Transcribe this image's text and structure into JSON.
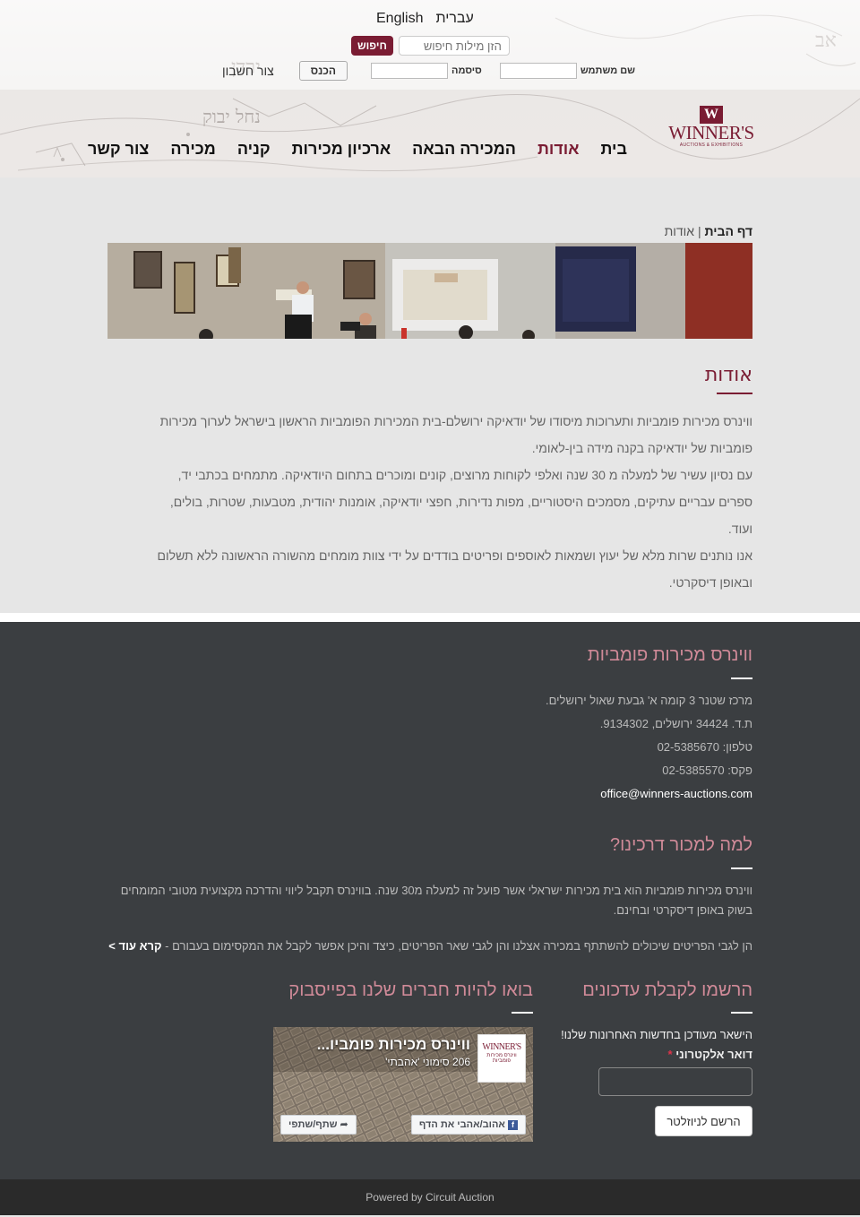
{
  "header": {
    "languages": [
      "English",
      "עברית"
    ],
    "search": {
      "placeholder": "הזן מילות חיפוש",
      "button": "חיפוש"
    },
    "login": {
      "username_label": "שם משתמש",
      "password_label": "סיסמה",
      "login_button": "הכנס",
      "create_account": "צור חשבון"
    },
    "logo": {
      "mark": "W",
      "name": "WINNER'S",
      "tagline": "AUCTIONS & EXHIBITIONS"
    },
    "nav": [
      "בית",
      "אודות",
      "המכירה הבאה",
      "ארכיון מכירות",
      "קניה",
      "מכירה",
      "צור קשר"
    ],
    "nav_active": "אודות"
  },
  "breadcrumb": {
    "home": "דף הבית",
    "separator": "|",
    "current": "אודות"
  },
  "about": {
    "title": "אודות",
    "paragraphs": [
      "ווינרס מכירות פומביות ותערוכות מיסודו של יודאיקה ירושלם-בית המכירות הפומביות הראשון בישראל לערוך מכירות",
      "פומביות של יודאיקה בקנה מידה בין-לאומי.",
      "עם נסיון עשיר של למעלה מ 30 שנה ואלפי לקוחות מרוצים, קונים ומוכרים בתחום היודאיקה. מתמחים בכתבי יד,",
      "ספרים עבריים עתיקים, מסמכים היסטוריים, מפות נדירות, חפצי יודאיקה, אומנות יהודית, מטבעות, שטרות, בולים,",
      "ועוד.",
      "אנו נותנים שרות מלא של יעוץ ושמאות לאוספים ופריטים בודדים על ידי צוות מומחים מהשורה הראשונה ללא תשלום",
      "ובאופן דיסקרטי."
    ]
  },
  "footer": {
    "contact": {
      "title": "ווינרס מכירות פומביות",
      "address": "מרכז שטנר 3 קומה א' גבעת שאול ירושלים.",
      "po_box": "ת.ד. 34424 ירושלים, 9134302.",
      "phone": "טלפון: 02-5385670",
      "fax": "פקס: 02-5385570",
      "email": "office@winners-auctions.com"
    },
    "why": {
      "title": "למה למכור דרכינו?",
      "line1": "ווינרס מכירות פומביות הוא בית מכירות ישראלי אשר פועל זה למעלה מ30 שנה. בווינרס תקבל ליווי והדרכה מקצועית מטובי המומחים",
      "line2": "בשוק באופן דיסקרטי ובחינם.",
      "line3": "הן לגבי הפריטים שיכולים להשתתף במכירה אצלנו והן לגבי שאר הפריטים, כיצד והיכן אפשר לקבל את המקסימום בעבורם -",
      "read_more": "קרא עוד >"
    },
    "newsletter": {
      "title": "הרשמו לקבלת עדכונים",
      "text": "הישאר מעודכן בחדשות האחרונות שלנו!",
      "email_label": "דואר אלקטרוני",
      "required": "*",
      "button": "הרשם לניוזלטר"
    },
    "facebook": {
      "title": "בואו להיות חברים שלנו בפייסבוק",
      "page_name": "ווינרס מכירות פומביו...",
      "likes": "206 סימוני 'אהבתי'",
      "like_button": "אהוב/אהבי את הדף",
      "share_button": "שתף/שתפי",
      "logo_text": "WINNER'S",
      "logo_sub": "ווינרס מכירות פומביות"
    },
    "powered_by": "Powered by Circuit Auction"
  },
  "colors": {
    "brand": "#7a1c33",
    "footer_bg": "#3b3e41",
    "footer_title": "#d08a98",
    "page_bg": "#e6e6e6"
  }
}
